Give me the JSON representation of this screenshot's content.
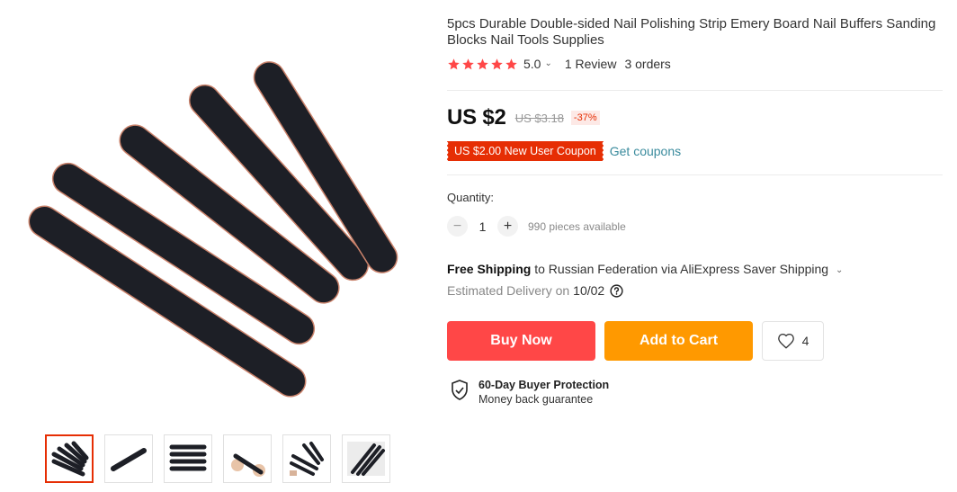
{
  "product": {
    "title": "5pcs Durable Double-sided Nail Polishing Strip Emery Board Nail Buffers Sanding Blocks Nail Tools Supplies",
    "rating": "5.0",
    "reviews": "1 Review",
    "orders": "3 orders"
  },
  "price": {
    "current": "US $2",
    "original": "US $3.18",
    "discount": "-37%"
  },
  "coupon": {
    "label": "US $2.00 New User Coupon",
    "link": "Get coupons"
  },
  "quantity": {
    "label": "Quantity:",
    "value": "1",
    "minus": "−",
    "plus": "+",
    "available": "990 pieces available"
  },
  "shipping": {
    "free": "Free Shipping",
    "detail": "to Russian Federation via AliExpress Saver Shipping",
    "delivery_label": "Estimated Delivery on",
    "delivery_date": "10/02"
  },
  "actions": {
    "buy": "Buy Now",
    "cart": "Add to Cart",
    "wishlist_count": "4"
  },
  "protection": {
    "title": "60-Day Buyer Protection",
    "subtitle": "Money back guarantee"
  },
  "colors": {
    "accent_red": "#ff4747",
    "accent_orange": "#ff9900",
    "coupon_red": "#e62e04",
    "link_teal": "#3a8b9d",
    "star": "#ff4747"
  },
  "icons": [
    "star-icon",
    "chevron-down-icon",
    "minus-icon",
    "plus-icon",
    "help-icon",
    "heart-icon",
    "shield-check-icon"
  ]
}
